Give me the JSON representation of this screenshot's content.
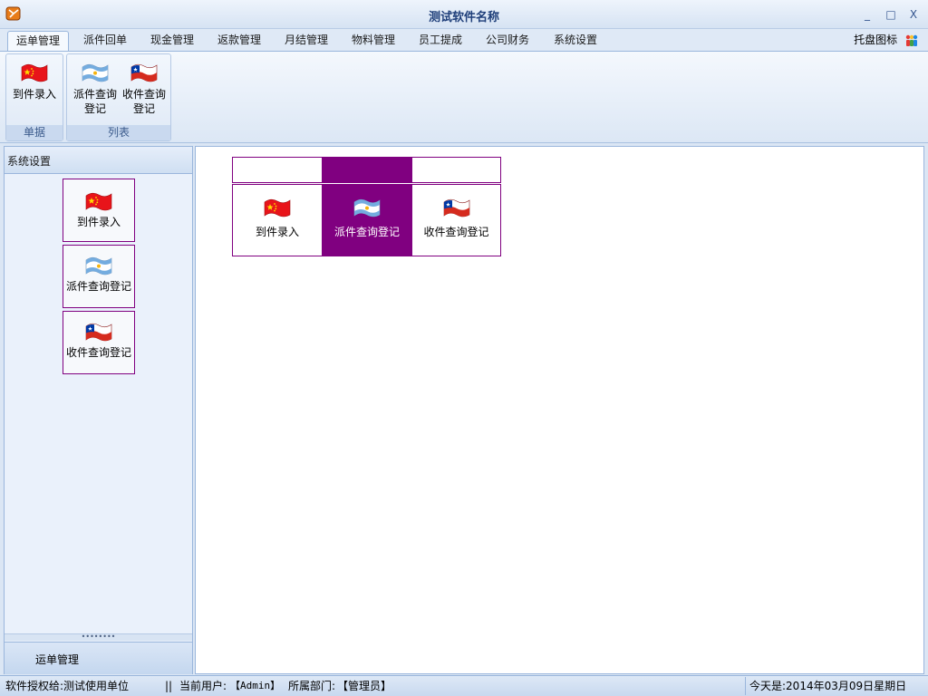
{
  "window": {
    "title": "测试软件名称",
    "minimize": "_",
    "maximize": "□",
    "close": "X"
  },
  "menu": {
    "tabs": [
      "运单管理",
      "派件回单",
      "现金管理",
      "返款管理",
      "月结管理",
      "物料管理",
      "员工提成",
      "公司财务",
      "系统设置"
    ],
    "active_index": 0,
    "tray_label": "托盘图标",
    "tray_icon": "users-icon"
  },
  "ribbon": {
    "groups": [
      {
        "label": "单据",
        "buttons": [
          {
            "label": "到件录入",
            "icon": "china-flag-icon"
          }
        ]
      },
      {
        "label": "列表",
        "buttons": [
          {
            "label": "派件查询登记",
            "icon": "argentina-flag-icon"
          },
          {
            "label": "收件查询登记",
            "icon": "chile-flag-icon"
          }
        ]
      }
    ]
  },
  "left_panel": {
    "header": "系统设置",
    "items": [
      {
        "label": "到件录入",
        "icon": "china-flag-icon"
      },
      {
        "label": "派件查询登记",
        "icon": "argentina-flag-icon"
      },
      {
        "label": "收件查询登记",
        "icon": "chile-flag-icon"
      }
    ],
    "splitter": "••••••••",
    "nav_label": "运单管理"
  },
  "main": {
    "selected_index": 1,
    "tiles": [
      {
        "label": "到件录入",
        "icon": "china-flag-icon"
      },
      {
        "label": "派件查询登记",
        "icon": "argentina-flag-icon"
      },
      {
        "label": "收件查询登记",
        "icon": "chile-flag-icon"
      }
    ]
  },
  "status": {
    "license": "软件授权给:测试使用单位",
    "separator": "||",
    "user_prefix": "当前用户:",
    "user": "【Admin】",
    "dept_prefix": "所属部门:",
    "dept": "【管理员】",
    "date": "今天是:2014年03月09日星期日"
  },
  "colors": {
    "accent": "#800080",
    "title_text": "#1f3f7a",
    "panel_bg": "#eaf1fb"
  }
}
